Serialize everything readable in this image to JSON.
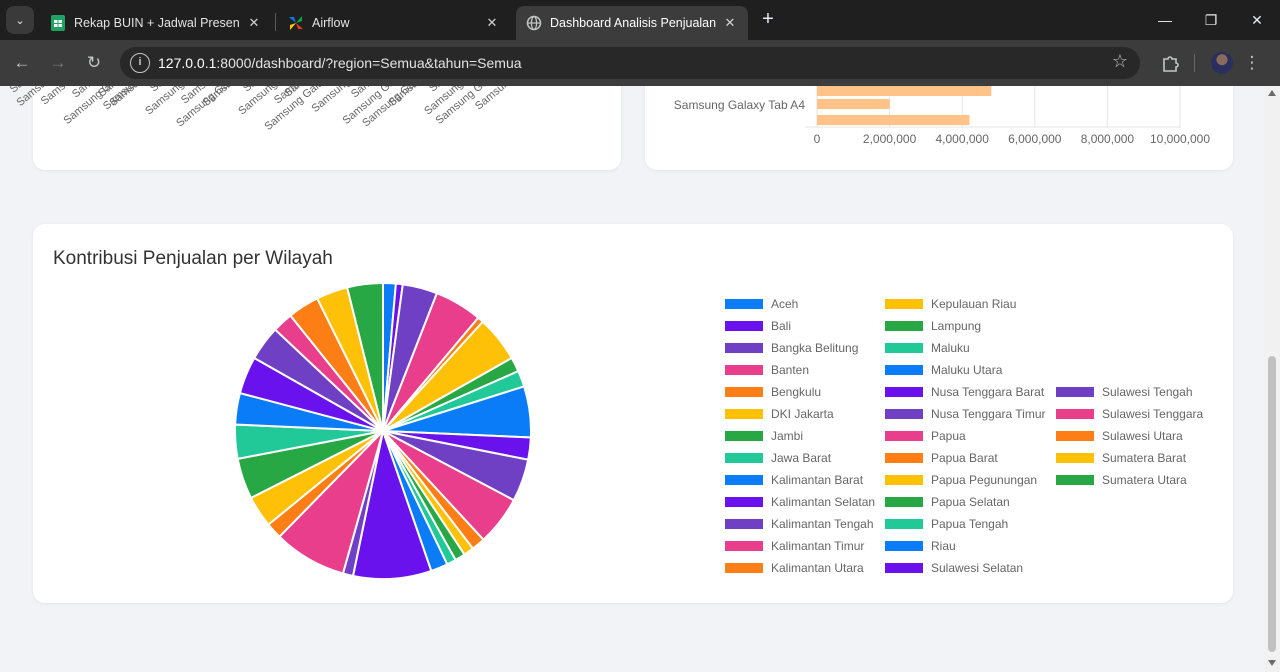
{
  "browser": {
    "tabs": [
      {
        "title": "Rekap BUIN + Jadwal Presentasi",
        "icon": "sheets-icon"
      },
      {
        "title": "Airflow",
        "icon": "airflow-icon"
      },
      {
        "title": "Dashboard Analisis Penjualan",
        "icon": "globe-icon"
      }
    ],
    "url_host": "127.0.0.1",
    "url_path": ":8000/dashboard/?region=Semua&tahun=Semua"
  },
  "top_left_chart": {
    "x_tick_labels": [
      "Samsung Gal",
      "Samsung Galax",
      "Samsung Gal",
      "Samsung",
      "Samsung Galax",
      "Samsung",
      "Samsung Gala",
      "Samsung Galax",
      "Samsung",
      "Samsung Gala",
      "Samsung",
      "Samsung Gala",
      "Samsung",
      "Samsung Galax",
      "Samsung",
      "Samsung Gala",
      "Samsung",
      "Samsung Galax",
      "Samsung Gala",
      "Samsung",
      "Samsung Galax",
      "Samsung",
      "Samsung Galax",
      "Samsung Gala",
      "Samsung",
      "Samsung Galax",
      "Samsung",
      "Samsung Gala",
      "Samsung Galax",
      "Samsung"
    ]
  },
  "chart_data": [
    {
      "type": "bar",
      "orientation": "horizontal",
      "categories": [
        "Samsung Galaxy Tab A4"
      ],
      "series": [
        {
          "values": [
            4800000,
            2000000,
            4200000
          ]
        }
      ],
      "x_ticks": [
        "0",
        "2,000,000",
        "4,000,000",
        "6,000,000",
        "8,000,000",
        "10,000,000"
      ],
      "xlim": [
        0,
        10000000
      ],
      "color": "#ffc38a"
    },
    {
      "type": "pie",
      "title": "Kontribusi Penjualan per Wilayah",
      "legend_position": "right",
      "categories": [
        "Aceh",
        "Bali",
        "Bangka Belitung",
        "Banten",
        "Bengkulu",
        "DKI Jakarta",
        "Jambi",
        "Jawa Barat",
        "Kalimantan Barat",
        "Kalimantan Selatan",
        "Kalimantan Tengah",
        "Kalimantan Timur",
        "Kalimantan Utara",
        "Kepulauan Riau",
        "Lampung",
        "Maluku",
        "Maluku Utara",
        "Nusa Tenggara Barat",
        "Nusa Tenggara Timur",
        "Papua",
        "Papua Barat",
        "Papua Pegunungan",
        "Papua Selatan",
        "Papua Tengah",
        "Riau",
        "Sulawesi Selatan",
        "Sulawesi Tengah",
        "Sulawesi Tenggara",
        "Sulawesi Utara",
        "Sumatera Barat",
        "Sumatera Utara"
      ],
      "values": [
        1.5,
        0.8,
        4.1,
        5.6,
        0.7,
        5.4,
        1.7,
        1.9,
        6.0,
        2.6,
        5.0,
        5.8,
        1.6,
        1.2,
        1.2,
        1.1,
        2.0,
        9.2,
        1.2,
        8.6,
        1.9,
        3.7,
        4.8,
        4.0,
        3.7,
        4.4,
        4.1,
        2.4,
        3.7,
        3.7,
        4.2
      ],
      "colors": [
        "#0a7cf7",
        "#6a12ee",
        "#7040c4",
        "#e83e8c",
        "#fd7e14",
        "#ffc107",
        "#28a745",
        "#20c997",
        "#0a7cf7",
        "#6a12ee",
        "#7040c4",
        "#e83e8c",
        "#fd7e14",
        "#ffc107",
        "#28a745",
        "#20c997",
        "#0a7cf7",
        "#6a12ee",
        "#7040c4",
        "#e83e8c",
        "#fd7e14",
        "#ffc107",
        "#28a745",
        "#20c997",
        "#0a7cf7",
        "#6a12ee",
        "#7040c4",
        "#e83e8c",
        "#fd7e14",
        "#ffc107",
        "#28a745"
      ]
    }
  ]
}
